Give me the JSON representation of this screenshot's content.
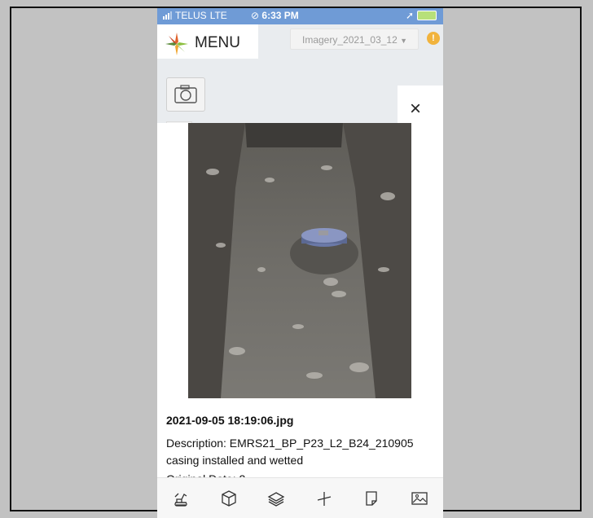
{
  "status_bar": {
    "carrier": "TELUS",
    "network": "LTE",
    "time": "6:33 PM",
    "time_icon": "link-icon"
  },
  "header": {
    "menu_label": "MENU",
    "imagery_select": "Imagery_2021_03_12",
    "warning_icon_text": "!"
  },
  "modal": {
    "close_label": "×",
    "filename": "2021-09-05 18:19:06.jpg",
    "description": "Description: EMRS21_BP_P23_L2_B24_210905 casing installed and wetted",
    "original_date": "Original Date: 2"
  },
  "toolbar": {
    "icons": [
      "excavator-icon",
      "cube-icon",
      "layers-icon",
      "measure-icon",
      "document-icon",
      "image-icon"
    ]
  },
  "colors": {
    "status_bar": "#6f9bd6",
    "background": "#c2c2c2",
    "warning": "#f1b33d"
  }
}
